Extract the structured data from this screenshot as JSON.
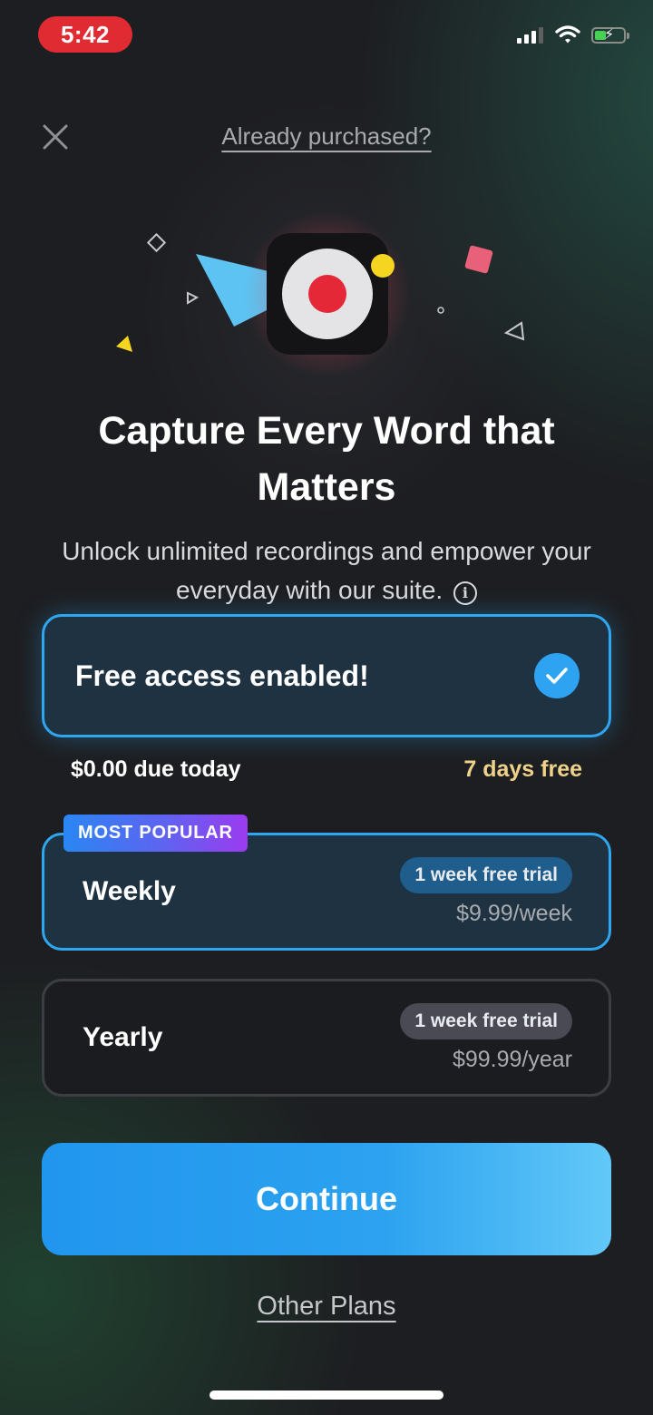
{
  "status_bar": {
    "time": "5:42",
    "icons": [
      "cellular-signal-icon",
      "wifi-icon",
      "battery-charging-icon"
    ],
    "battery_color": "#47d154"
  },
  "nav": {
    "close_icon": "close-icon",
    "already_purchased": "Already purchased?"
  },
  "hero": {
    "app_icon": "record-app-icon",
    "accent_red": "#e52838",
    "accent_yellow": "#f6d521",
    "accent_blue": "#5cc3f2"
  },
  "headline": {
    "title": "Capture Every Word that Matters",
    "subtitle": "Unlock unlimited recordings and empower your everyday with our suite.",
    "info_icon": "info-icon"
  },
  "free_access": {
    "label": "Free access enabled!",
    "checked": true,
    "due_today": "$0.00 due today",
    "free_days": "7 days free"
  },
  "plans": [
    {
      "name": "Weekly",
      "badge": "MOST POPULAR",
      "trial": "1 week free trial",
      "price": "$9.99/week",
      "selected": true
    },
    {
      "name": "Yearly",
      "trial": "1 week free trial",
      "price": "$99.99/year",
      "selected": false
    }
  ],
  "actions": {
    "continue": "Continue",
    "other_plans": "Other Plans"
  },
  "colors": {
    "primary_blue": "#2fa6f0",
    "background": "#1d1e21",
    "due_highlight": "#efd28a"
  }
}
